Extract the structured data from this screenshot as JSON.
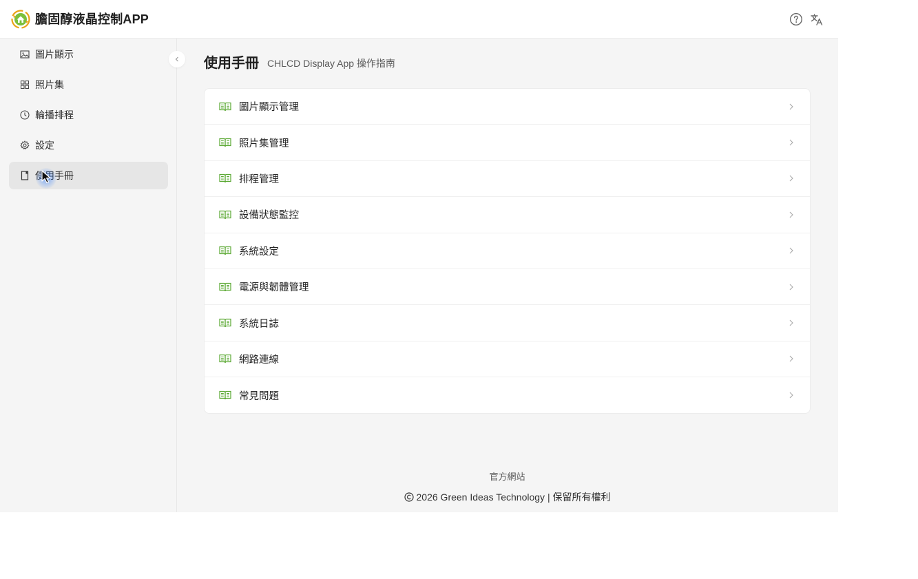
{
  "header": {
    "app_title": "膽固醇液晶控制APP",
    "logo_icon": "recycle-home-icon",
    "help_icon": "help-circle-icon",
    "language_icon": "translate-icon",
    "accent_color": "#52a32b"
  },
  "sidebar": {
    "items": [
      {
        "label": "圖片顯示",
        "icon": "image-icon",
        "active": false
      },
      {
        "label": "照片集",
        "icon": "grid-icon",
        "active": false
      },
      {
        "label": "輪播排程",
        "icon": "clock-icon",
        "active": false
      },
      {
        "label": "設定",
        "icon": "gear-icon",
        "active": false
      },
      {
        "label": "使用手冊",
        "icon": "book-icon",
        "active": true
      }
    ],
    "collapse_icon": "chevron-left-icon"
  },
  "main": {
    "title": "使用手冊",
    "subtitle": "CHLCD Display App 操作指南",
    "sections": [
      {
        "label": "圖片顯示管理"
      },
      {
        "label": "照片集管理"
      },
      {
        "label": "排程管理"
      },
      {
        "label": "設備狀態監控"
      },
      {
        "label": "系統設定"
      },
      {
        "label": "電源與韌體管理"
      },
      {
        "label": "系統日誌"
      },
      {
        "label": "網路連線"
      },
      {
        "label": "常見問題"
      }
    ],
    "section_icon": "open-book-icon",
    "chevron_icon": "chevron-right-icon"
  },
  "footer": {
    "website_link": "官方網站",
    "copyright": "2026 Green Ideas Technology | 保留所有權利"
  }
}
